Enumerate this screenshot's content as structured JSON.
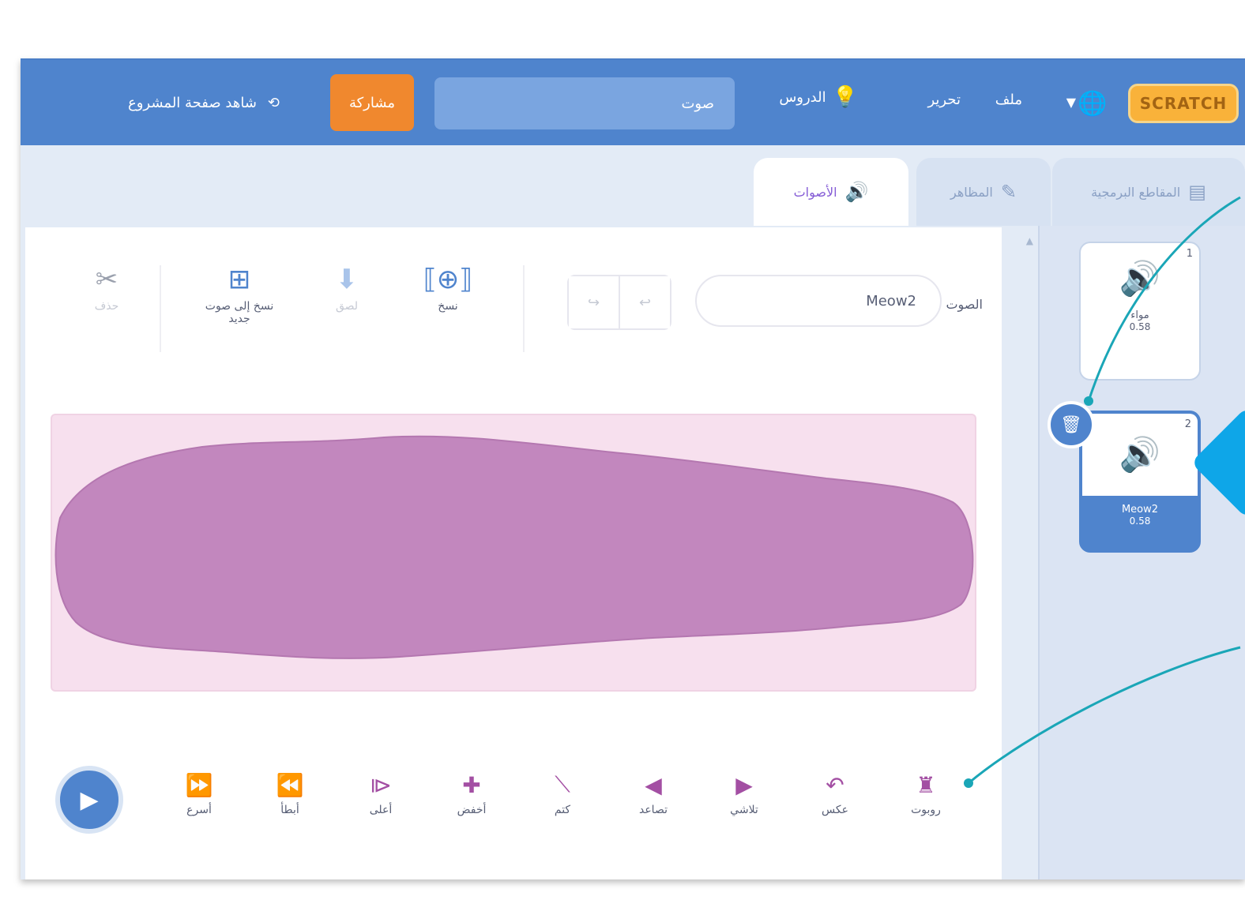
{
  "topbar": {
    "logo": "SCRATCH",
    "menu_file": "ملف",
    "menu_edit": "تحرير",
    "tutorials": "الدروس",
    "project_title": "صوت",
    "share": "مشاركة",
    "see_project_page": "شاهد صفحة المشروع"
  },
  "tabs": {
    "code": "المقاطع البرمجية",
    "costumes": "المظاهر",
    "sounds": "الأصوات"
  },
  "sound_list": [
    {
      "number": "1",
      "name": "مواء",
      "duration": "0.58"
    },
    {
      "number": "2",
      "name": "Meow2",
      "duration": "0.58"
    }
  ],
  "editor": {
    "sound_label": "الصوت",
    "sound_name": "Meow2",
    "tools": {
      "copy": "نسخ",
      "paste": "لصق",
      "copy_to_new": "نسخ إلى صوت جديد",
      "delete": "حذف"
    },
    "effects": {
      "robot": "روبوت",
      "reverse": "عكس",
      "louder": "أعلى",
      "softer": "أخفض",
      "mute": "كتم",
      "fade_in": "تصاعد",
      "fade_out": "تلاشي",
      "faster": "أسرع",
      "slower": "أبطأ"
    }
  },
  "icons": {
    "globe": "globe-icon",
    "bulb": "lightbulb-icon",
    "scissors": "scissors-icon",
    "play": "play-icon",
    "trash": "trash-icon"
  },
  "colors": {
    "topbar": "#4f84cd",
    "share": "#f0882e",
    "waveform": "#c287be",
    "effects": "#a34fa3"
  }
}
